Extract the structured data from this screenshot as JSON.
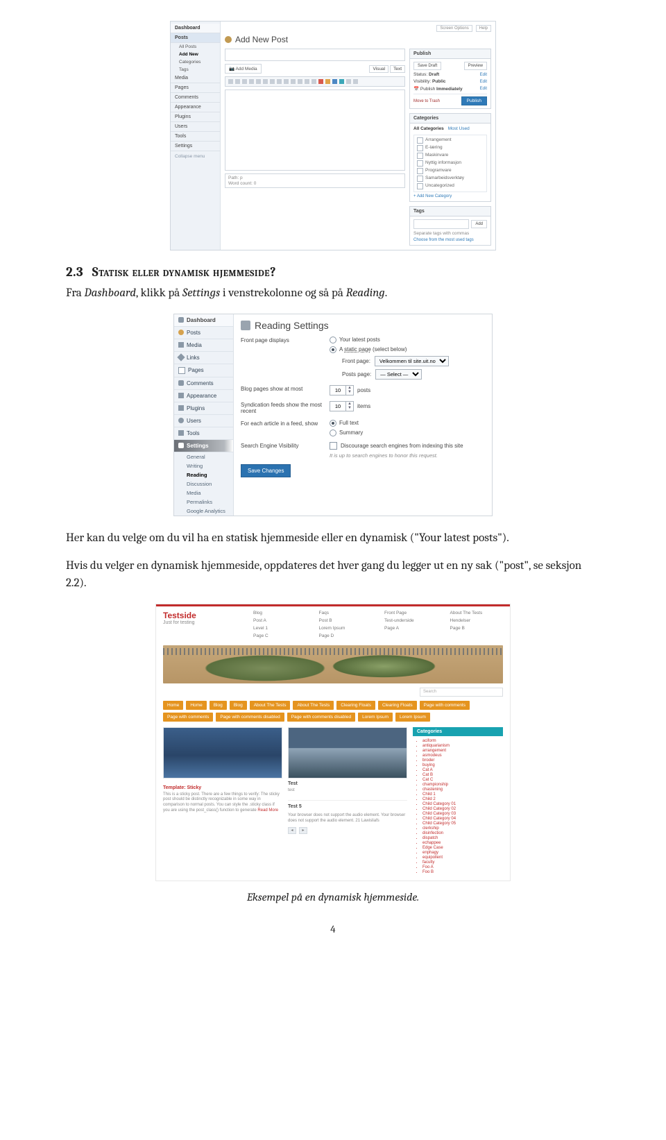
{
  "section": {
    "number": "2.3",
    "title": "Statisk eller dynamisk hjemmeside?"
  },
  "para1": {
    "pre": "Fra ",
    "w1": "Dashboard",
    "mid1": ", klikk på ",
    "w2": "Settings",
    "mid2": " i venstrekolonne og så på ",
    "w3": "Reading",
    "end": "."
  },
  "para2": "Her kan du velge om du vil ha en statisk hjemmeside eller en dynamisk (\"Your latest posts\").",
  "para3": "Hvis du velger en dynamisk hjemmeside, oppdateres det hver gang du legger ut en ny sak (\"post\", se seksjon 2.2).",
  "caption": "Eksempel på en dynamisk hjemmeside.",
  "page_number": "4",
  "wp1": {
    "top_right": {
      "screen_options": "Screen Options",
      "help": "Help"
    },
    "title": "Add New Post",
    "side": {
      "dashboard": "Dashboard",
      "posts": "Posts",
      "posts_sub": [
        "All Posts",
        "Add New",
        "Categories",
        "Tags"
      ],
      "media": "Media",
      "pages": "Pages",
      "comments": "Comments",
      "appearance": "Appearance",
      "plugins": "Plugins",
      "users": "Users",
      "tools": "Tools",
      "settings": "Settings",
      "collapse": "Collapse menu"
    },
    "editor": {
      "add_media": "Add Media",
      "tab_visual": "Visual",
      "tab_text": "Text",
      "path_label": "Path: p",
      "wordcount": "Word count: 0"
    },
    "publish": {
      "heading": "Publish",
      "save_draft": "Save Draft",
      "preview": "Preview",
      "status_label": "Status:",
      "status_value": "Draft",
      "visibility_label": "Visibility:",
      "visibility_value": "Public",
      "publish_label": "Publish",
      "publish_value": "Immediately",
      "edit": "Edit",
      "trash": "Move to Trash",
      "button": "Publish"
    },
    "categories_box": {
      "heading": "Categories",
      "tab_all": "All Categories",
      "tab_most": "Most Used",
      "items": [
        "Arrangement",
        "E-læring",
        "Maskinvare",
        "Nyttig informasjon",
        "Programvare",
        "Samarbeidsverktøy",
        "Uncategorized"
      ],
      "add_new": "+ Add New Category"
    },
    "tags_box": {
      "heading": "Tags",
      "add": "Add",
      "hint": "Separate tags with commas",
      "choose": "Choose from the most used tags"
    }
  },
  "wp2": {
    "title": "Reading Settings",
    "side": {
      "dashboard": "Dashboard",
      "posts": "Posts",
      "media": "Media",
      "links": "Links",
      "pages": "Pages",
      "comments": "Comments",
      "appearance": "Appearance",
      "plugins": "Plugins",
      "users": "Users",
      "tools": "Tools",
      "settings": "Settings",
      "subs": [
        "General",
        "Writing",
        "Reading",
        "Discussion",
        "Media",
        "Permalinks",
        "Google Analytics"
      ]
    },
    "front": {
      "label": "Front page displays",
      "opt_latest": "Your latest posts",
      "opt_static_pre": "A ",
      "opt_static_link": "static page",
      "opt_static_post": " (select below)",
      "front_page_lbl": "Front page:",
      "front_page_val": "Velkommen til site.uit.no",
      "posts_page_lbl": "Posts page:",
      "posts_page_val": "— Select —"
    },
    "blog_pages": {
      "label": "Blog pages show at most",
      "value": "10",
      "unit": "posts"
    },
    "synd": {
      "label": "Syndication feeds show the most recent",
      "value": "10",
      "unit": "items"
    },
    "feed": {
      "label": "For each article in a feed, show",
      "opt_full": "Full text",
      "opt_summary": "Summary"
    },
    "sev": {
      "label": "Search Engine Visibility",
      "check": "Discourage search engines from indexing this site",
      "hint": "It is up to search engines to honor this request."
    },
    "save": "Save Changes"
  },
  "tp": {
    "brand": "Testside",
    "tagline": "Just for testing",
    "nav": [
      "Blog",
      "Faqs",
      "Front Page",
      "About The Tests",
      "Post A",
      "Post B",
      "Test-underside",
      "Hendelser",
      "Level 1",
      "Lorem Ipsum",
      "Page A",
      "Page B",
      "Page C",
      "Page D"
    ],
    "search_placeholder": "Search",
    "pills_row1": [
      "Home",
      "Home",
      "Blog",
      "Blog",
      "About The Tests",
      "About The Tests",
      "Clearing Floats",
      "Clearing Floats",
      "Page with comments"
    ],
    "pills_row2": [
      "Page with comments",
      "Page with comments disabled",
      "Page with comments disabled",
      "Lorem Ipsum",
      "Lorem Ipsum"
    ],
    "card1": {
      "title": "Template: Sticky",
      "text": "This is a sticky post. There are a few things to verify: The sticky post should be distinctly recognizable in some way in comparison to normal posts. You can style the .sticky class if you are using the post_class() function to generate ",
      "more": "Read More"
    },
    "card2": {
      "t1": "Test",
      "v1": "test",
      "t2": "Test 5",
      "text": "Your browser does not support the audio element. Your browser does not support the audio element. 21 Lawisliafs"
    },
    "catbox": {
      "heading": "Categories",
      "items": [
        "aciform",
        "antiquarianism",
        "arrangement",
        "asmodeus",
        "broder",
        "buying",
        "Cat A",
        "Cat B",
        "Cat C",
        "championship",
        "chastening",
        "Child 1",
        "Child 2",
        "Child Category 01",
        "Child Category 02",
        "Child Category 03",
        "Child Category 04",
        "Child Category 05",
        "clerkship",
        "disinfection",
        "dispatch",
        "echappee",
        "Edge Case",
        "enphagy",
        "equipollent",
        "faculty",
        "Foo A",
        "Foo B"
      ]
    }
  }
}
